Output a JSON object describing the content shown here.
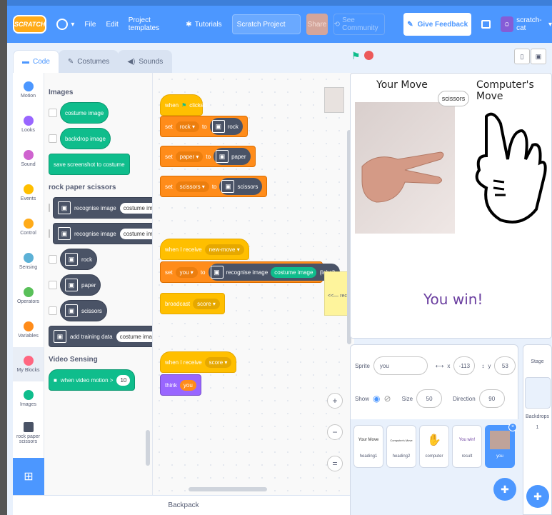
{
  "menu": {
    "logo": "SCRATCH",
    "file": "File",
    "edit": "Edit",
    "templates": "Project templates",
    "tutorials": "Tutorials",
    "project_title": "Scratch Project",
    "share": "Share",
    "community": "See Community",
    "feedback": "Give Feedback",
    "username": "scratch-cat"
  },
  "tabs": {
    "code": "Code",
    "costumes": "Costumes",
    "sounds": "Sounds"
  },
  "categories": [
    {
      "label": "Motion",
      "color": "#4c97ff"
    },
    {
      "label": "Looks",
      "color": "#9966ff"
    },
    {
      "label": "Sound",
      "color": "#cf63cf"
    },
    {
      "label": "Events",
      "color": "#ffbf00"
    },
    {
      "label": "Control",
      "color": "#ffab19"
    },
    {
      "label": "Sensing",
      "color": "#5cb1d6"
    },
    {
      "label": "Operators",
      "color": "#59c059"
    },
    {
      "label": "Variables",
      "color": "#ff8c1a"
    },
    {
      "label": "My Blocks",
      "color": "#ff6680"
    },
    {
      "label": "Images",
      "color": "#0fbd8c"
    },
    {
      "label": "rock paper scissors",
      "color": "#4a5366"
    }
  ],
  "palette": {
    "images_head": "Images",
    "costume_image": "costume image",
    "backdrop_image": "backdrop image",
    "save_screenshot": "save screenshot to costume",
    "rps_head": "rock paper scissors",
    "recognise_image": "recognise image",
    "rock": "rock",
    "paper": "paper",
    "scissors": "scissors",
    "add_training": "add training data",
    "video_head": "Video Sensing",
    "video_motion": "when video motion >",
    "video_value": "10"
  },
  "script1": {
    "when": "when",
    "clicked": "clicked",
    "set": "set",
    "to": "to",
    "rock_var": "rock",
    "rock_val": "rock",
    "paper_var": "paper",
    "paper_val": "paper",
    "scissors_var": "scissors",
    "scissors_val": "scissors"
  },
  "script2": {
    "when_receive": "when I receive",
    "msg": "new-move",
    "set": "set",
    "var": "you",
    "to": "to",
    "recognise": "recognise image",
    "costume": "costume image",
    "label": "(label)",
    "broadcast": "broadcast",
    "score": "score"
  },
  "script3": {
    "when_receive": "when I receive",
    "msg": "score",
    "think": "think",
    "you": "you"
  },
  "comment": "<<— recog",
  "zoom": {
    "in": "+",
    "out": "−",
    "reset": "="
  },
  "backpack": "Backpack",
  "stage": {
    "your_move": "Your Move",
    "computer_move": "Computer's Move",
    "bubble": "scissors",
    "result": "You win!"
  },
  "sprite_info": {
    "sprite_label": "Sprite",
    "sprite_name": "you",
    "x_label": "x",
    "x_value": "-113",
    "y_label": "y",
    "y_value": "53",
    "show_label": "Show",
    "size_label": "Size",
    "size_value": "50",
    "direction_label": "Direction",
    "direction_value": "90"
  },
  "sprites": [
    {
      "name": "heading1",
      "preview": "Your Move"
    },
    {
      "name": "heading2",
      "preview": "Computer's Move"
    },
    {
      "name": "computer",
      "preview": ""
    },
    {
      "name": "result",
      "preview": "You win!"
    },
    {
      "name": "you",
      "preview": ""
    }
  ],
  "stage_pane": {
    "title": "Stage",
    "backdrops_label": "Backdrops",
    "backdrops_count": "1"
  }
}
